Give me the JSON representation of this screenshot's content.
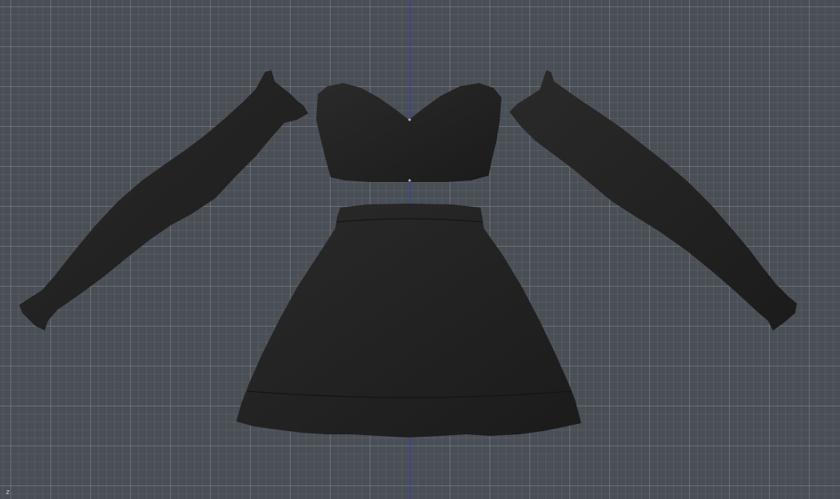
{
  "viewport": {
    "background": "#4a4f56",
    "grid_color": "#8c929c",
    "axis_color": "#2f3cc9"
  },
  "model": {
    "color": "#1e1e1e",
    "highlight": "#2a2a2a",
    "parts": [
      "left-sleeve",
      "bandeau-top",
      "right-sleeve",
      "skirt"
    ]
  },
  "axis_indicator": {
    "label": "z"
  }
}
